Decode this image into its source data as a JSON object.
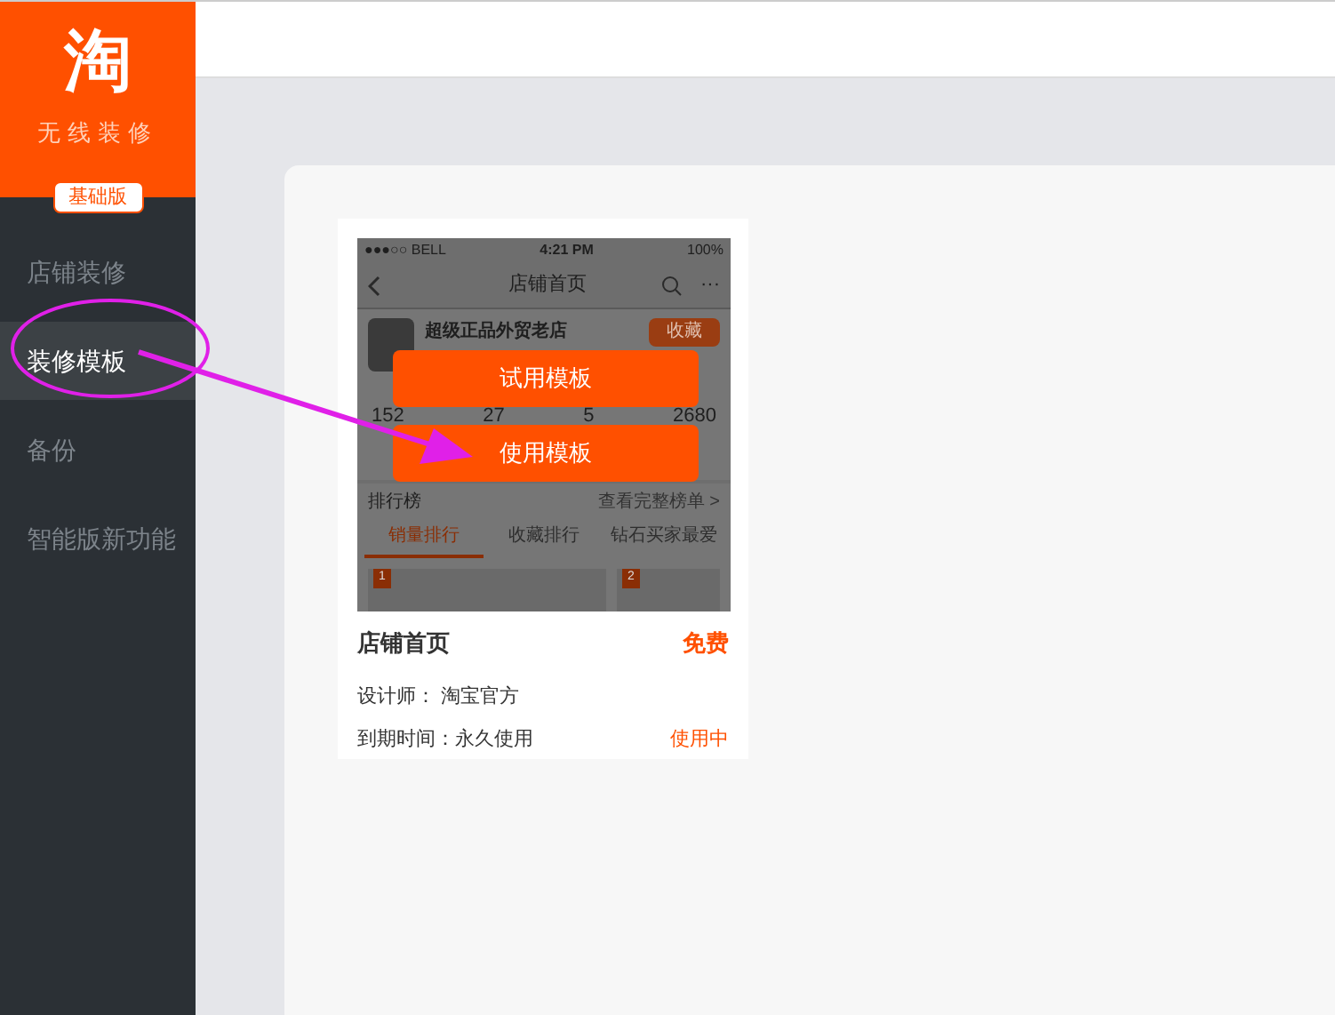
{
  "logo": {
    "glyph": "淘",
    "subtitle": "无线装修",
    "edition": "基础版"
  },
  "sidebar": {
    "items": [
      {
        "label": "店铺装修",
        "selected": false
      },
      {
        "label": "装修模板",
        "selected": true
      },
      {
        "label": "备份",
        "selected": false
      },
      {
        "label": "智能版新功能",
        "selected": false
      }
    ]
  },
  "template_card": {
    "preview": {
      "status_bar": {
        "carrier": "●●●○○ BELL",
        "time": "4:21 PM",
        "battery": "100%"
      },
      "nav_title": "店铺首页",
      "more": "···",
      "shop_name": "超级正品外贸老店",
      "favorite": "收藏",
      "stats": [
        "152",
        "27",
        "5",
        "2680"
      ],
      "ranking": {
        "title": "排行榜",
        "link": "查看完整榜单 >"
      },
      "tabs": [
        {
          "label": "销量排行",
          "selected": true
        },
        {
          "label": "收藏排行",
          "selected": false
        },
        {
          "label": "钻石买家最爱",
          "selected": false
        }
      ],
      "ranks": [
        "1",
        "2"
      ]
    },
    "actions": [
      {
        "label": "试用模板"
      },
      {
        "label": "使用模板"
      }
    ],
    "title": "店铺首页",
    "price": "免费",
    "designer": "设计师： 淘宝官方",
    "expiry": "到期时间：永久使用",
    "status": "使用中"
  }
}
